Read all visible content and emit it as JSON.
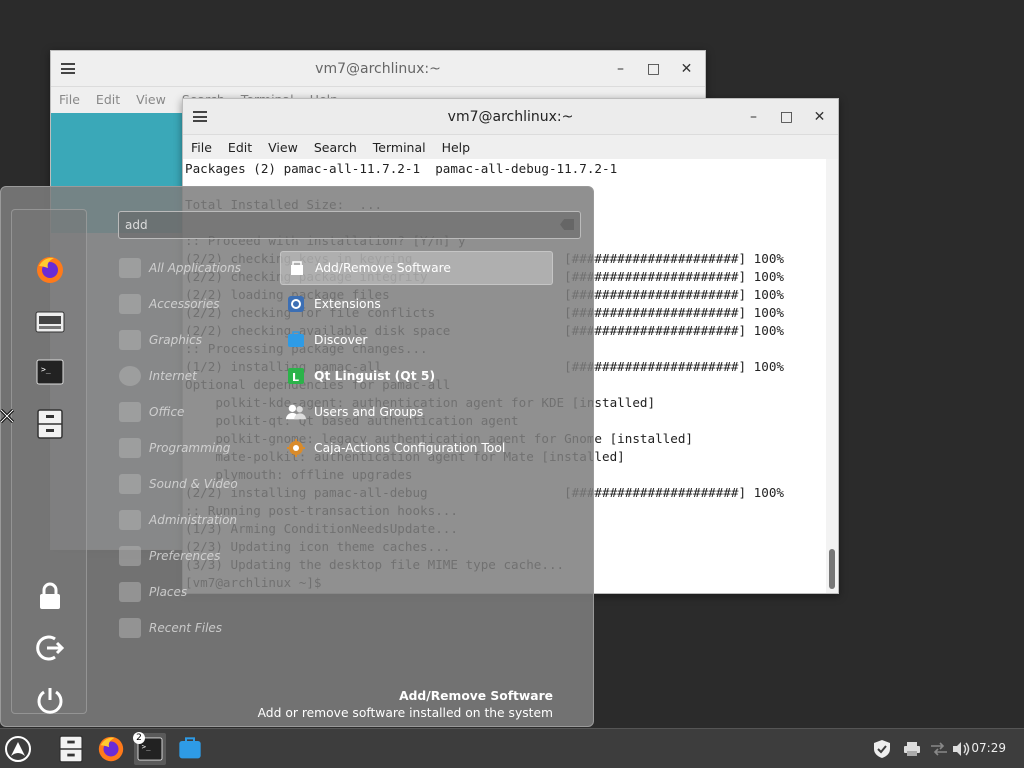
{
  "back_window": {
    "title": "vm7@archlinux:~",
    "menu": [
      "File",
      "Edit",
      "View",
      "Search",
      "Terminal",
      "Help"
    ]
  },
  "front_window": {
    "title": "vm7@archlinux:~",
    "menu": [
      "File",
      "Edit",
      "View",
      "Search",
      "Terminal",
      "Help"
    ],
    "terminal_lines": [
      "Packages (2) pamac-all-11.7.2-1  pamac-all-debug-11.7.2-1",
      "",
      "Total Installed Size:  ...",
      "",
      ":: Proceed with installation? [Y/n] y",
      "(2/2) checking keys in keyring                    [######################] 100%",
      "(2/2) checking package integrity                  [######################] 100%",
      "(2/2) loading package files                       [######################] 100%",
      "(2/2) checking for file conflicts                 [######################] 100%",
      "(2/2) checking available disk space               [######################] 100%",
      ":: Processing package changes...",
      "(1/2) installing pamac-all                        [######################] 100%",
      "Optional dependencies for pamac-all",
      "    polkit-kde-agent: authentication agent for KDE [installed]",
      "    polkit-qt: Qt based authentication agent",
      "    polkit-gnome: legacy authentication agent for Gnome [installed]",
      "    mate-polkit: authentication agent for Mate [installed]",
      "    plymouth: offline upgrades",
      "(2/2) installing pamac-all-debug                  [######################] 100%",
      ":: Running post-transaction hooks...",
      "(1/3) Arming ConditionNeedsUpdate...",
      "(2/3) Updating icon theme caches...",
      "(3/3) Updating the desktop file MIME type cache...",
      "[vm7@archlinux ~]$ "
    ]
  },
  "app_menu": {
    "search": {
      "value": "add",
      "placeholder": ""
    },
    "categories": [
      {
        "label": "All Applications",
        "icon": "grid-icon"
      },
      {
        "label": "Accessories",
        "icon": "accessories-icon"
      },
      {
        "label": "Graphics",
        "icon": "graphics-icon"
      },
      {
        "label": "Internet",
        "icon": "globe-icon"
      },
      {
        "label": "Office",
        "icon": "office-icon"
      },
      {
        "label": "Programming",
        "icon": "programming-icon"
      },
      {
        "label": "Sound & Video",
        "icon": "media-icon"
      },
      {
        "label": "Administration",
        "icon": "admin-icon"
      },
      {
        "label": "Preferences",
        "icon": "preferences-icon"
      },
      {
        "label": "Places",
        "icon": "folder-icon"
      },
      {
        "label": "Recent Files",
        "icon": "recent-icon"
      }
    ],
    "apps": [
      {
        "label": "Add/Remove Software",
        "icon": "package-icon",
        "selected": true
      },
      {
        "label": "Extensions",
        "icon": "extensions-icon"
      },
      {
        "label": "Discover",
        "icon": "discover-icon"
      },
      {
        "label": "Qt Linguist (Qt 5)",
        "icon": "linguist-icon"
      },
      {
        "label": "Users and Groups",
        "icon": "users-icon"
      },
      {
        "label": "Caja-Actions Configuration Tool",
        "icon": "caja-actions-icon"
      }
    ],
    "description": {
      "title": "Add/Remove Software",
      "text": "Add or remove software installed on the system"
    }
  },
  "taskbar": {
    "terminal_badge": "2",
    "clock": "07:29"
  },
  "colors": {
    "menu_bg": "#7e7e7e",
    "taskbar_bg": "#3d3d3d",
    "firefox_orange": "#ff7a1a"
  }
}
